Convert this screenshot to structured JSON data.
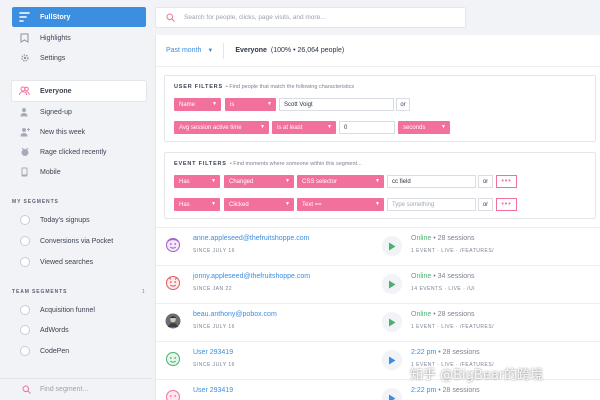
{
  "sidebar": {
    "brand": "FullStory",
    "nav": [
      {
        "label": "Highlights",
        "icon": "bookmark-icon"
      },
      {
        "label": "Settings",
        "icon": "gear-icon"
      }
    ],
    "segments": [
      {
        "label": "Everyone",
        "icon": "people-icon",
        "active": true
      },
      {
        "label": "Signed-up",
        "icon": "person-check-icon"
      },
      {
        "label": "New this week",
        "icon": "person-plus-icon"
      },
      {
        "label": "Rage clicked recently",
        "icon": "rage-icon"
      },
      {
        "label": "Mobile",
        "icon": "mobile-icon"
      }
    ],
    "my_segments_heading": "MY SEGMENTS",
    "my_segments": [
      "Today's signups",
      "Conversions via Pocket",
      "Viewed searches"
    ],
    "team_segments_heading": "TEAM SEGMENTS",
    "team_segments_count": "1",
    "team_segments": [
      "Acquisition funnel",
      "AdWords",
      "CodePen"
    ],
    "find_placeholder": "Find segment..."
  },
  "search": {
    "placeholder": "Search for people, clicks, page visits, and more..."
  },
  "segment_bar": {
    "period": "Past month",
    "name": "Everyone",
    "stats": "(100% • 26,064 people)"
  },
  "user_filters": {
    "title": "USER FILTERS",
    "hint": "• Find people that match the following characteristics",
    "rows": [
      {
        "field": "Name",
        "op": "is",
        "value": "Scott Voigt",
        "or": "or"
      },
      {
        "field": "Avg session active time",
        "op": "is at least",
        "value": "0",
        "unit": "seconds"
      }
    ]
  },
  "event_filters": {
    "title": "EVENT FILTERS",
    "hint": "• Find moments where someone within this segment...",
    "rows": [
      {
        "verb": "Has",
        "action": "Changed",
        "target": "CSS selector",
        "value": "cc field",
        "placeholder": "",
        "or": "or",
        "more": "•••"
      },
      {
        "verb": "Has",
        "action": "Clicked",
        "target": "Text ==",
        "value": "",
        "placeholder": "Type something",
        "or": "or",
        "more": "•••"
      }
    ]
  },
  "people": [
    {
      "name": "anne.appleseed@thefruitshoppe.com",
      "since": "SINCE JULY 16",
      "status": "Online",
      "sessions": "• 28 sessions",
      "events": "1 EVENT · LIVE · /FEATURES/",
      "avatar": "face-purple",
      "live": true
    },
    {
      "name": "jonny.appleseed@thefruitshoppe.com",
      "since": "SINCE JAN 22",
      "status": "Online",
      "sessions": "• 34 sessions",
      "events": "14 EVENTS · LIVE · /UI",
      "avatar": "face-red",
      "live": true
    },
    {
      "name": "beau.anthony@pobox.com",
      "since": "SINCE JULY 16",
      "status": "Online",
      "sessions": "• 28 sessions",
      "events": "1 EVENT · LIVE · /FEATURES/",
      "avatar": "photo-gray",
      "live": true
    },
    {
      "name": "User 293419",
      "since": "SINCE JULY 16",
      "status": "2:22 pm",
      "sessions": "• 28 sessions",
      "events": "1 EVENT · LIVE · /FEATURES/",
      "avatar": "face-green",
      "live": false
    },
    {
      "name": "User 293419",
      "since": "",
      "status": "2:22 pm",
      "sessions": "• 28 sessions",
      "events": "",
      "avatar": "face-pink",
      "live": false
    }
  ],
  "watermark": "知乎 @BigBear的跨境",
  "colors": {
    "accent": "#3c8ee0",
    "filter_pink": "#f2709c",
    "online_green": "#46b26f"
  }
}
